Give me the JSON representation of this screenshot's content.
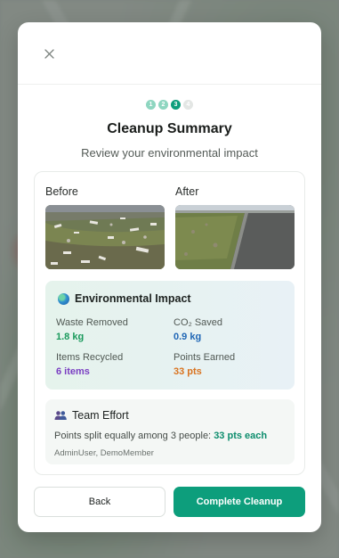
{
  "steps": [
    "1",
    "2",
    "3",
    "4"
  ],
  "current_step": 3,
  "title": "Cleanup Summary",
  "subtitle": "Review your environmental impact",
  "photos": {
    "before_label": "Before",
    "after_label": "After"
  },
  "impact": {
    "title": "Environmental Impact",
    "waste_label": "Waste Removed",
    "waste_value": "1.8 kg",
    "co2_label": "CO₂ Saved",
    "co2_value": "0.9 kg",
    "items_label": "Items Recycled",
    "items_value": "6 items",
    "points_label": "Points Earned",
    "points_value": "33 pts"
  },
  "team": {
    "title": "Team Effort",
    "split_text": "Points split equally among 3 people:",
    "split_value": "33 pts each",
    "members": "AdminUser, DemoMember"
  },
  "buttons": {
    "back": "Back",
    "complete": "Complete Cleanup"
  },
  "colors": {
    "accent": "#0d9e7c",
    "waste": "#1a9a5c",
    "co2": "#1f66b5",
    "items": "#7a3fc2",
    "points": "#d9731f"
  }
}
